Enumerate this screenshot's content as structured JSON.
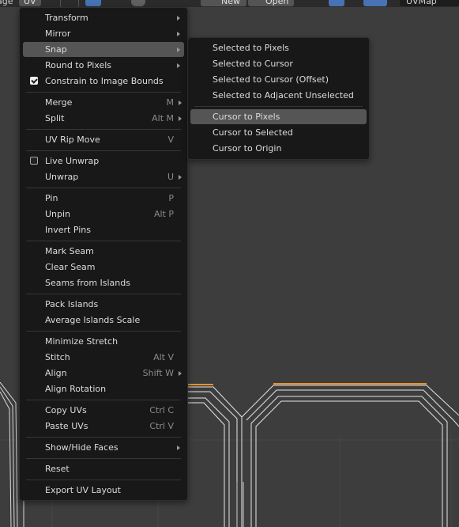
{
  "header": {
    "left_fragment": "age",
    "uv_menu": "UV",
    "new_button": "New",
    "open_button": "Open",
    "uv_map": "UVMap"
  },
  "main_menu": {
    "items": [
      {
        "label": "Transform",
        "shortcut": "",
        "submenu": true
      },
      {
        "label": "Mirror",
        "shortcut": "",
        "submenu": true
      },
      {
        "label": "Snap",
        "shortcut": "",
        "submenu": true,
        "highlighted": true
      },
      {
        "label": "Round to Pixels",
        "shortcut": "",
        "submenu": true
      },
      {
        "label": "Constrain to Image Bounds",
        "shortcut": "",
        "checkbox": true,
        "checked": true
      },
      {
        "label": "Merge",
        "shortcut": "M",
        "submenu": true
      },
      {
        "label": "Split",
        "shortcut": "Alt M",
        "submenu": true
      },
      {
        "label": "UV Rip Move",
        "shortcut": "V"
      },
      {
        "label": "Live Unwrap",
        "shortcut": "",
        "checkbox": true,
        "checked": false
      },
      {
        "label": "Unwrap",
        "shortcut": "U",
        "submenu": true
      },
      {
        "label": "Pin",
        "shortcut": "P"
      },
      {
        "label": "Unpin",
        "shortcut": "Alt P"
      },
      {
        "label": "Invert Pins",
        "shortcut": ""
      },
      {
        "label": "Mark Seam",
        "shortcut": ""
      },
      {
        "label": "Clear Seam",
        "shortcut": ""
      },
      {
        "label": "Seams from Islands",
        "shortcut": ""
      },
      {
        "label": "Pack Islands",
        "shortcut": ""
      },
      {
        "label": "Average Islands Scale",
        "shortcut": ""
      },
      {
        "label": "Minimize Stretch",
        "shortcut": ""
      },
      {
        "label": "Stitch",
        "shortcut": "Alt V"
      },
      {
        "label": "Align",
        "shortcut": "Shift W",
        "submenu": true
      },
      {
        "label": "Align Rotation",
        "shortcut": ""
      },
      {
        "label": "Copy UVs",
        "shortcut": "Ctrl C"
      },
      {
        "label": "Paste UVs",
        "shortcut": "Ctrl V"
      },
      {
        "label": "Show/Hide Faces",
        "shortcut": "",
        "submenu": true
      },
      {
        "label": "Reset",
        "shortcut": ""
      },
      {
        "label": "Export UV Layout",
        "shortcut": ""
      }
    ]
  },
  "snap_submenu": {
    "items": [
      {
        "label": "Selected to Pixels"
      },
      {
        "label": "Selected to Cursor"
      },
      {
        "label": "Selected to Cursor (Offset)"
      },
      {
        "label": "Selected to Adjacent Unselected"
      },
      {
        "label": "Cursor to Pixels",
        "highlighted": true
      },
      {
        "label": "Cursor to Selected"
      },
      {
        "label": "Cursor to Origin"
      }
    ]
  },
  "colors": {
    "menu_bg": "#181818",
    "highlight": "#555555",
    "viewport_bg": "#3d3d3d",
    "selected_edge": "#e8912d"
  }
}
